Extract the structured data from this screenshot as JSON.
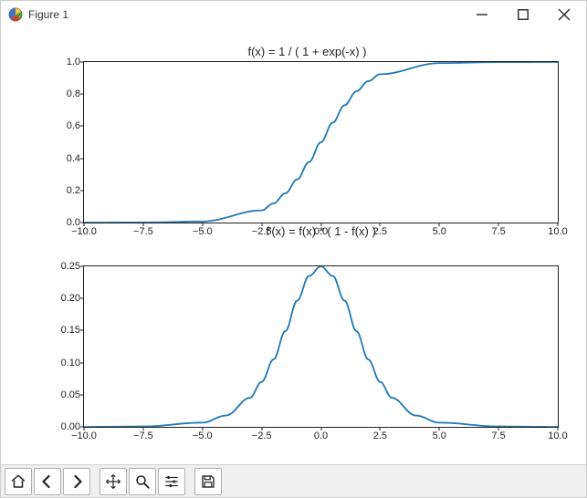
{
  "window": {
    "title": "Figure 1",
    "buttons": {
      "minimize": "–",
      "maximize": "▢",
      "close": "✕"
    }
  },
  "toolbar": {
    "home": "Home",
    "back": "Back",
    "forward": "Forward",
    "pan": "Pan",
    "zoom": "Zoom",
    "configure": "Configure subplots",
    "save": "Save"
  },
  "colors": {
    "line": "#1f77b4",
    "axes": "#222222"
  },
  "chart_data": [
    {
      "type": "line",
      "title": "f(x) = 1 / ( 1 + exp(-x) )",
      "xlabel": "",
      "ylabel": "",
      "xlimits": [
        -10,
        10
      ],
      "ylimits": [
        0,
        1
      ],
      "xticks": [
        -10.0,
        -7.5,
        -5.0,
        -2.5,
        0.0,
        2.5,
        5.0,
        7.5,
        10.0
      ],
      "yticks": [
        0.0,
        0.2,
        0.4,
        0.6,
        0.8,
        1.0
      ],
      "x": [
        -10.0,
        -7.5,
        -5.0,
        -2.5,
        -2.0,
        -1.5,
        -1.0,
        -0.5,
        0.0,
        0.5,
        1.0,
        1.5,
        2.0,
        2.5,
        5.0,
        7.5,
        10.0
      ],
      "y": [
        0.0,
        0.0006,
        0.0067,
        0.0759,
        0.1192,
        0.1824,
        0.2689,
        0.3775,
        0.5,
        0.6225,
        0.7311,
        0.8176,
        0.8808,
        0.9241,
        0.9933,
        0.9994,
        1.0
      ]
    },
    {
      "type": "line",
      "title": "f'(x) = f(x) * ( 1 - f(x) )",
      "xlabel": "",
      "ylabel": "",
      "xlimits": [
        -10,
        10
      ],
      "ylimits": [
        0,
        0.25
      ],
      "xticks": [
        -10.0,
        -7.5,
        -5.0,
        -2.5,
        0.0,
        2.5,
        5.0,
        7.5,
        10.0
      ],
      "yticks": [
        0.0,
        0.05,
        0.1,
        0.15,
        0.2,
        0.25
      ],
      "x": [
        -10.0,
        -7.5,
        -5.0,
        -4.0,
        -3.0,
        -2.5,
        -2.0,
        -1.5,
        -1.0,
        -0.5,
        0.0,
        0.5,
        1.0,
        1.5,
        2.0,
        2.5,
        3.0,
        4.0,
        5.0,
        7.5,
        10.0
      ],
      "y": [
        0.0,
        0.0006,
        0.0066,
        0.0177,
        0.0452,
        0.0701,
        0.105,
        0.1491,
        0.1966,
        0.235,
        0.25,
        0.235,
        0.1966,
        0.1491,
        0.105,
        0.0701,
        0.0452,
        0.0177,
        0.0066,
        0.0006,
        0.0
      ]
    }
  ]
}
